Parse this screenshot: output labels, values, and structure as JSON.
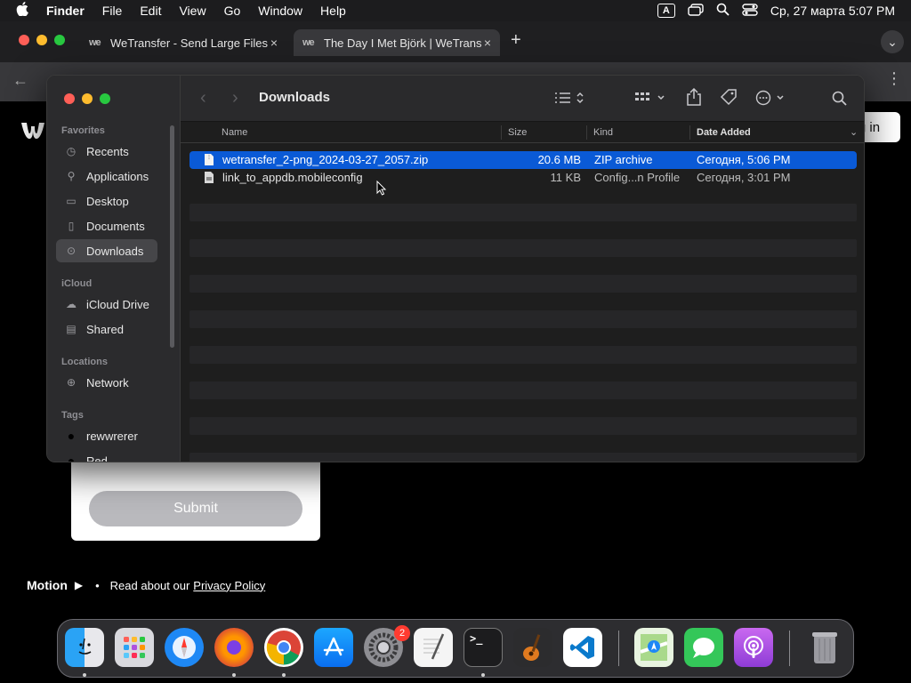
{
  "menubar": {
    "apple": "",
    "app_name": "Finder",
    "items": [
      "File",
      "Edit",
      "View",
      "Go",
      "Window",
      "Help"
    ],
    "input_indicator": "A",
    "datetime": "Ср, 27 марта  5:07 PM"
  },
  "browser": {
    "tabs": [
      {
        "favicon": "we",
        "title": "WeTransfer - Send Large Files",
        "close": "×"
      },
      {
        "favicon": "we",
        "title": "The Day I Met Björk | WeTrans",
        "close": "×"
      }
    ],
    "new_tab": "+",
    "tab_menu": "⌄",
    "login_label": "g in"
  },
  "finder": {
    "title": "Downloads",
    "sidebar": {
      "favorites_label": "Favorites",
      "favorites": [
        {
          "icon": "clock-icon",
          "label": "Recents"
        },
        {
          "icon": "apps-icon",
          "label": "Applications"
        },
        {
          "icon": "desktop-icon",
          "label": "Desktop"
        },
        {
          "icon": "document-icon",
          "label": "Documents"
        },
        {
          "icon": "download-icon",
          "label": "Downloads",
          "selected": true
        }
      ],
      "icloud_label": "iCloud",
      "icloud": [
        {
          "icon": "cloud-icon",
          "label": "iCloud Drive"
        },
        {
          "icon": "shared-folder-icon",
          "label": "Shared"
        }
      ],
      "locations_label": "Locations",
      "locations": [
        {
          "icon": "globe-icon",
          "label": "Network"
        }
      ],
      "tags_label": "Tags",
      "tags": [
        {
          "color": "#000000",
          "label": "rewwrerer"
        },
        {
          "color": "#000000",
          "label": "Red"
        }
      ]
    },
    "columns": {
      "name": "Name",
      "size": "Size",
      "kind": "Kind",
      "date_added": "Date Added"
    },
    "files": [
      {
        "name": "wetransfer_2-png_2024-03-27_2057.zip",
        "size": "20.6 MB",
        "kind": "ZIP archive",
        "date": "Сегодня, 5:06 PM",
        "selected": true
      },
      {
        "name": "link_to_appdb.mobileconfig",
        "size": "11 KB",
        "kind": "Config...n Profile",
        "date": "Сегодня, 3:01 PM",
        "selected": false
      }
    ]
  },
  "webpage": {
    "submit_label": "Submit",
    "motion_label": "Motion",
    "read_about": "Read about our",
    "privacy_link": "Privacy Policy"
  },
  "dock": {
    "apps": [
      "Finder",
      "Launchpad",
      "Safari",
      "Firefox",
      "Chrome",
      "App Store",
      "System Settings",
      "TextEdit",
      "Terminal",
      "GarageBand",
      "VS Code",
      "Maps",
      "Messages",
      "Podcasts",
      "Trash"
    ],
    "settings_badge": "2"
  },
  "colors": {
    "selection": "#0a5ad6",
    "accent_red": "#ff5f57",
    "accent_yellow": "#febc2e",
    "accent_green": "#28c840"
  }
}
